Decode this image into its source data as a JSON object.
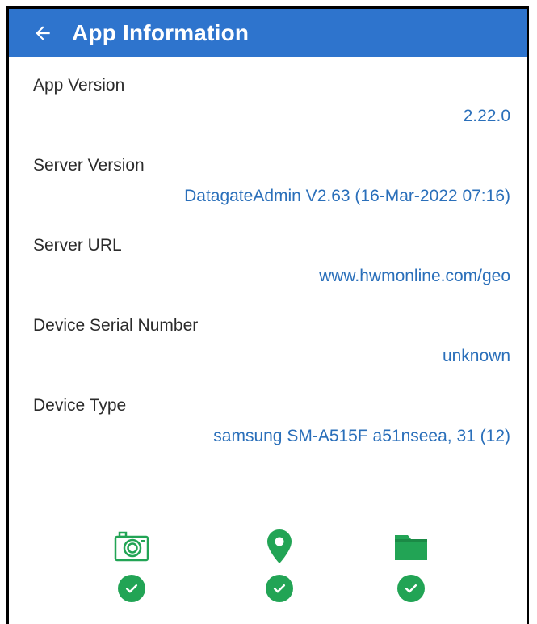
{
  "header": {
    "title": "App Information",
    "back_icon": "arrow-left-icon",
    "color": "#2e74cd"
  },
  "info_rows": [
    {
      "label": "App Version",
      "value": "2.22.0"
    },
    {
      "label": "Server Version",
      "value": "DatagateAdmin V2.63 (16-Mar-2022 07:16)"
    },
    {
      "label": "Server URL",
      "value": "www.hwmonline.com/geo"
    },
    {
      "label": "Device Serial Number",
      "value": "unknown"
    },
    {
      "label": "Device Type",
      "value": "samsung SM-A515F a51nseea, 31 (12)"
    }
  ],
  "permissions": [
    {
      "icon": "camera-icon",
      "status": "granted"
    },
    {
      "icon": "location-pin-icon",
      "status": "granted"
    },
    {
      "icon": "folder-icon",
      "status": "granted"
    }
  ],
  "colors": {
    "value_text": "#2a6fba",
    "status_green": "#22a455"
  }
}
